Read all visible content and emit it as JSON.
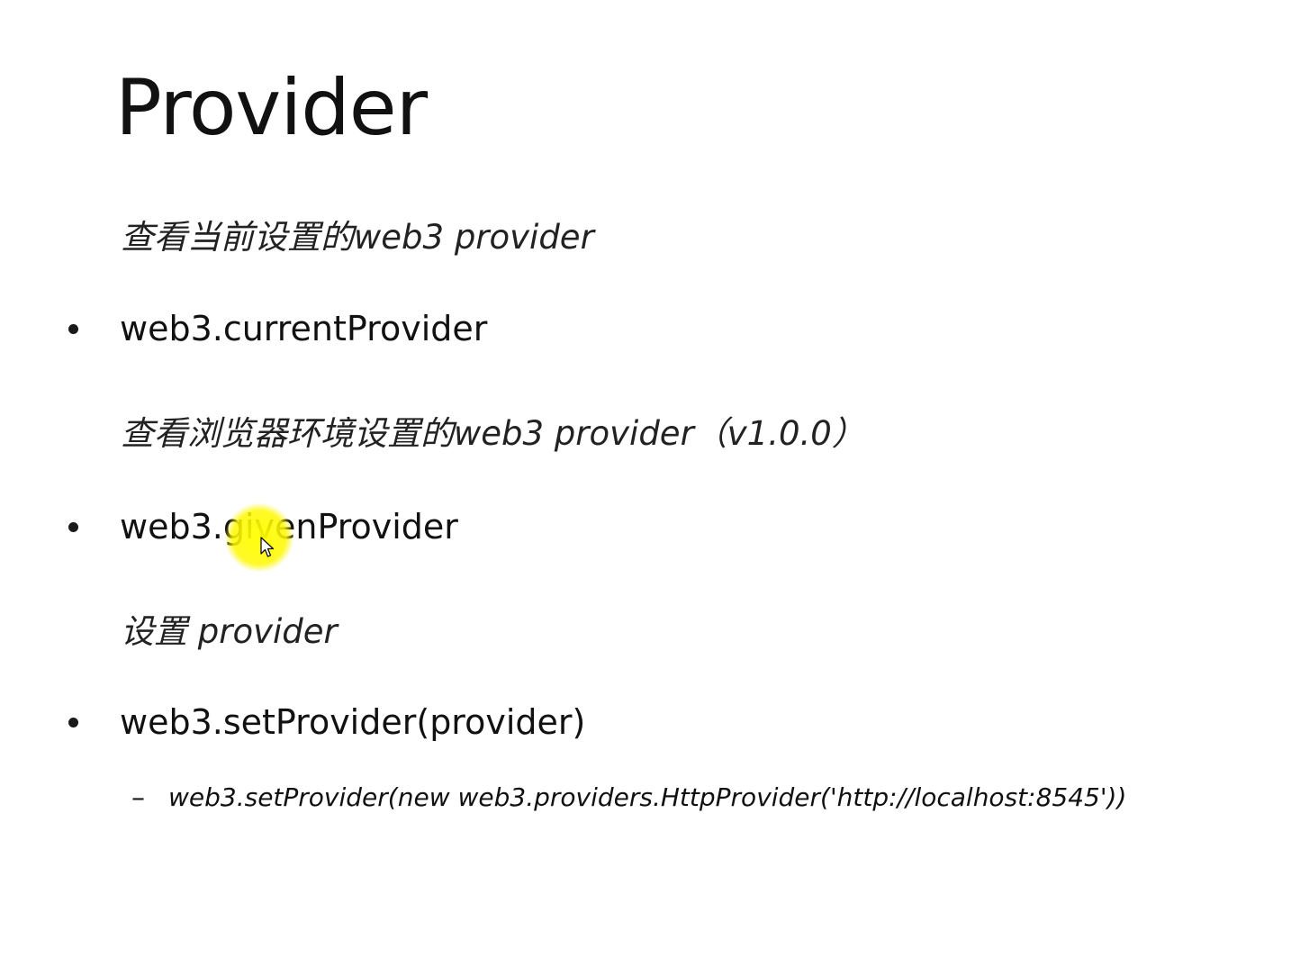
{
  "slide": {
    "title": "Provider",
    "sections": [
      {
        "note": "查看当前设置的web3 provider",
        "bullet": "web3.currentProvider"
      },
      {
        "note": "查看浏览器环境设置的web3 provider（v1.0.0）",
        "bullet": "web3.givenProvider"
      },
      {
        "note": "设置 provider",
        "bullet": "web3.setProvider(provider)",
        "sub_bullet": "web3.setProvider(new web3.providers.HttpProvider('http://localhost:8545'))"
      }
    ],
    "sub_marker": "–",
    "cursor_highlight_color": "#FFF200"
  }
}
